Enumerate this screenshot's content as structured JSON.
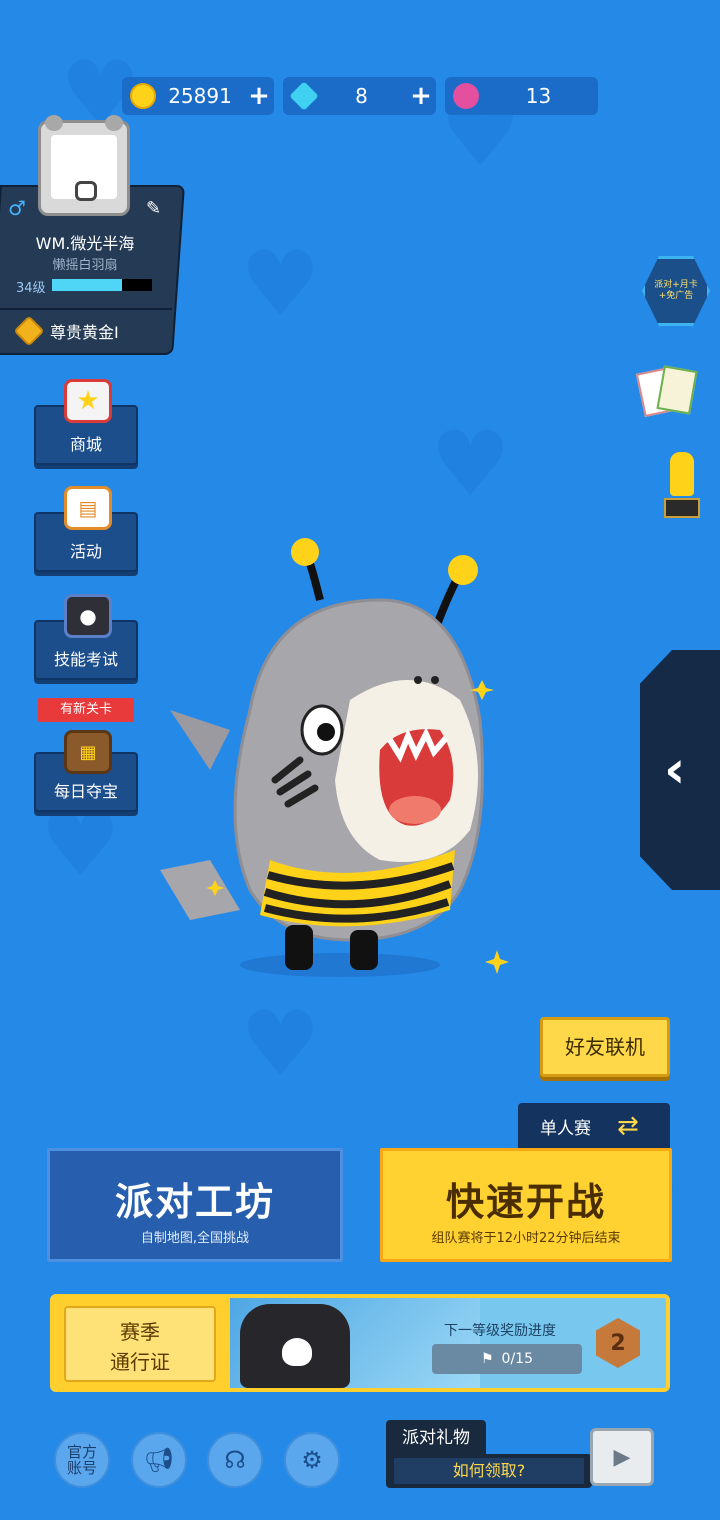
{
  "currency": {
    "coins": "25891",
    "gems": "8",
    "tokens": "13",
    "plus": "+"
  },
  "profile": {
    "nickname": "WM.微光半海",
    "title": "懒摇白羽扇",
    "level": "34级",
    "level_progress": 0.7,
    "rank": "尊贵黄金I",
    "gender_icon": "♂"
  },
  "side_menu": [
    {
      "label": "商城"
    },
    {
      "label": "活动"
    },
    {
      "label": "技能考试"
    },
    {
      "label": "每日夺宝"
    }
  ],
  "new_tag": "有新关卡",
  "right_icons": {
    "ad_free_card": "派对+月卡\n+免广告",
    "drawer_arrow": "‹"
  },
  "buttons": {
    "friends": "好友联机",
    "mode": "单人赛",
    "party_title": "派对工坊",
    "party_sub": "自制地图,全国挑战",
    "quick_title": "快速开战",
    "quick_sub": "组队赛将于12小时22分钟后结束"
  },
  "season_pass": {
    "label_line1": "赛季",
    "label_line2": "通行证",
    "progress_title": "下一等级奖励进度",
    "progress_value": "0/15",
    "level": "2"
  },
  "bottom": {
    "official_line1": "官方",
    "official_line2": "账号",
    "gift_title": "派对礼物",
    "gift_sub": "如何领取?"
  },
  "colors": {
    "background": "#2589e8",
    "accent_yellow": "#ffd232",
    "dark_panel": "#243a55"
  }
}
